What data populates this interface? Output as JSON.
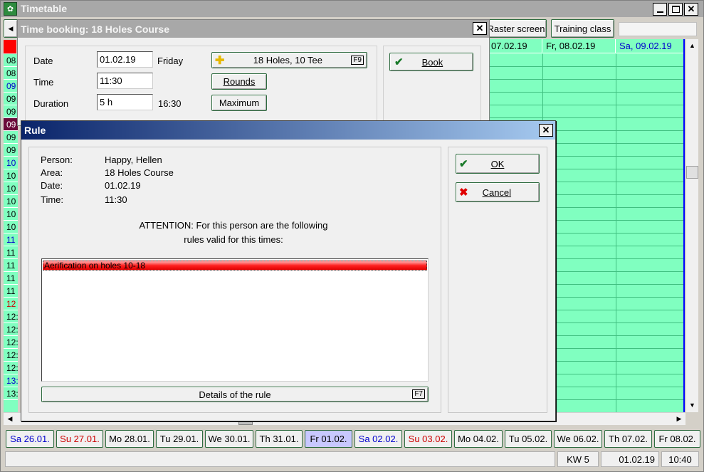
{
  "app": {
    "title": "Timetable"
  },
  "toolbar": {
    "raster_label": "Raster screen",
    "training_label": "Training class"
  },
  "grid": {
    "headers": [
      "07.02.19",
      "Fr, 08.02.19",
      "Sa, 09.02.19"
    ],
    "time_rows": [
      {
        "label": "08",
        "color": "#000000"
      },
      {
        "label": "08",
        "color": "#000000"
      },
      {
        "label": "09",
        "color": "#0000cc"
      },
      {
        "label": "09",
        "color": "#000000"
      },
      {
        "label": "09",
        "color": "#000000"
      },
      {
        "label": "09",
        "color": "#ffffff",
        "highlight": true
      },
      {
        "label": "09",
        "color": "#000000"
      },
      {
        "label": "09",
        "color": "#000000"
      },
      {
        "label": "10",
        "color": "#0000cc"
      },
      {
        "label": "10",
        "color": "#000000"
      },
      {
        "label": "10",
        "color": "#000000"
      },
      {
        "label": "10",
        "color": "#000000"
      },
      {
        "label": "10",
        "color": "#000000"
      },
      {
        "label": "10",
        "color": "#000000"
      },
      {
        "label": "11",
        "color": "#0000cc"
      },
      {
        "label": "11",
        "color": "#000000"
      },
      {
        "label": "11",
        "color": "#000000"
      },
      {
        "label": "11",
        "color": "#000000"
      },
      {
        "label": "11",
        "color": "#000000"
      },
      {
        "label": "12",
        "color": "#cc0000"
      },
      {
        "label": "12:",
        "color": "#000000"
      },
      {
        "label": "12:",
        "color": "#000000"
      },
      {
        "label": "12:",
        "color": "#000000"
      },
      {
        "label": "12:",
        "color": "#000000"
      },
      {
        "label": "12:",
        "color": "#000000"
      },
      {
        "label": "13:",
        "color": "#0000cc"
      },
      {
        "label": "13:",
        "color": "#000000"
      }
    ]
  },
  "booking": {
    "title": "Time booking: 18 Holes Course",
    "date_label": "Date",
    "date_value": "01.02.19",
    "weekday": "Friday",
    "course_button": "18 Holes, 10 Tee",
    "course_key": "F9",
    "time_label": "Time",
    "time_value": "11:30",
    "rounds_button": "Rounds",
    "duration_label": "Duration",
    "duration_value": "5 h",
    "end_time": "16:30",
    "maximum_button": "Maximum",
    "book_button": "Book"
  },
  "rule": {
    "title": "Rule",
    "person_label": "Person:",
    "person_value": "Happy, Hellen",
    "area_label": "Area:",
    "area_value": "18 Holes Course",
    "date_label": "Date:",
    "date_value": "01.02.19",
    "time_label": "Time:",
    "time_value": "11:30",
    "attention_line1": "ATTENTION: For this person are the following",
    "attention_line2": "rules valid for this times:",
    "rules": [
      "Aerification on holes 10-18"
    ],
    "details_button": "Details of the rule",
    "details_key": "F7",
    "ok_button": "OK",
    "cancel_button": "Cancel"
  },
  "date_tabs": [
    {
      "label": "Sa 26.01.",
      "color": "#0000cc"
    },
    {
      "label": "Su 27.01.",
      "color": "#cc0000"
    },
    {
      "label": "Mo 28.01.",
      "color": "#000000"
    },
    {
      "label": "Tu 29.01.",
      "color": "#000000"
    },
    {
      "label": "We 30.01.",
      "color": "#000000"
    },
    {
      "label": "Th 31.01.",
      "color": "#000000"
    },
    {
      "label": "Fr 01.02.",
      "color": "#000000",
      "selected": true
    },
    {
      "label": "Sa 02.02.",
      "color": "#0000cc"
    },
    {
      "label": "Su 03.02.",
      "color": "#cc0000"
    },
    {
      "label": "Mo 04.02.",
      "color": "#000000"
    },
    {
      "label": "Tu 05.02.",
      "color": "#000000"
    },
    {
      "label": "We 06.02.",
      "color": "#000000"
    },
    {
      "label": "Th 07.02.",
      "color": "#000000"
    },
    {
      "label": "Fr 08.02.",
      "color": "#000000"
    }
  ],
  "status": {
    "week": "KW 5",
    "date": "01.02.19",
    "time": "10:40"
  },
  "colors": {
    "grid_green": "#80ffc0",
    "title_grey": "#a8a8a8",
    "rule_title_start": "#0a246a",
    "rule_title_end": "#a6caf0",
    "rule_row_red": "#ff2020"
  }
}
